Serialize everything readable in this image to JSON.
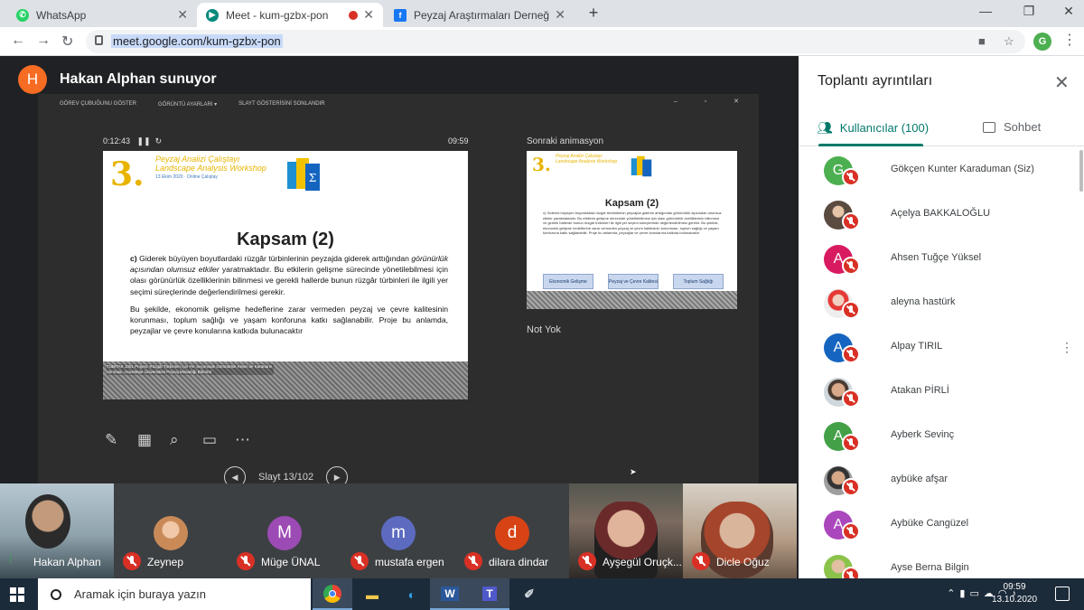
{
  "browser": {
    "tabs": [
      {
        "title": "WhatsApp",
        "favicon_color": "#25d366",
        "icon": "whatsapp-icon"
      },
      {
        "title": "Meet - kum-gzbx-pon",
        "favicon_color": "#00897b",
        "icon": "meet-icon",
        "recording_dot_color": "#d93025"
      },
      {
        "title": "Peyzaj Araştırmaları Derneği - An",
        "favicon_color": "#1877f2",
        "icon": "facebook-icon"
      }
    ],
    "new_tab": "+",
    "url": "meet.google.com/kum-gzbx-pon",
    "profile_initial": "G"
  },
  "meet": {
    "presenter_initial": "H",
    "presenter_label": "Hakan Alphan sunuyor",
    "presenter_avatar_color": "#f76c23",
    "presentation": {
      "toolbar": [
        "GÖREV ÇUBUĞUNU GÖSTER",
        "GÖRÜNTÜ AYARLARI ▾",
        "SLAYT GÖSTERİSİNİ SONLANDIR"
      ],
      "elapsed": "0:12:43",
      "clock": "09:59",
      "next_label": "Sonraki animasyon",
      "notes": "Not Yok",
      "slide_counter": "Slayt 13/102",
      "slide": {
        "logo_number": "3.",
        "logo_line1": "Peyzaj Analizi Çalıştayı",
        "logo_line2": "Landscape Analysis Workshop",
        "logo_sub": "13 Ekim 2020 · Online Çalıştay",
        "title": "Kapsam (2)",
        "p1_lead": "c)",
        "p1_a": " Giderek büyüyen boyutlardaki rüzgâr türbinlerinin peyzajda giderek arttığından ",
        "p1_em": "görünürlük açısından olumsuz etkiler",
        "p1_b": " yaratmaktadır. Bu etkilerin gelişme sürecinde yönetilebilmesi için olası görünürlük özelliklerinin bilinmesi ve gerekli hallerde bunun rüzgâr türbinleri ile ilgili yer seçimi süreçlerinde değerlendirilmesi gerekir.",
        "p2": "Bu şekilde, ekonomik gelişme hedeflerine zarar vermeden peyzaj ve çevre kalitesinin korunması, toplum sağlığı ve yaşam konforuna katkı sağlanabilir. Proje bu anlamda, peyzajlar ve çevre konularına katkıda bulunacaktır",
        "footer": "TÜBİTAK 1001 Projesi: Rüzgâr Türbinleri İçin Yer Seçiminde Görünürlük Kriteri ile Kararların Alınması, Hacettepe Üniversitesi Peyzaj Mimarlığı Bölümü"
      },
      "next_slide": {
        "number": "3.",
        "logo": "Peyzaj Analizi Çalıştayı Landscape Analysis Workshop",
        "title": "Kapsam (2)",
        "body": "c) Giderek büyüyen boyutlardaki rüzgâr türbinlerinin peyzajda giderek arttığından görünürlük açısından olumsuz etkiler yaratmaktadır. Bu etkilerin gelişme sürecinde yönetilebilmesi için olası görünürlük özelliklerinin bilinmesi ve gerekli hallerde bunun rüzgâr türbinleri ile ilgili yer seçimi süreçlerinde değerlendirilmesi gerekir. Bu şekilde, ekonomik gelişme hedeflerine zarar vermeden peyzaj ve çevre kalitesinin korunması, toplum sağlığı ve yaşam konforuna katkı sağlanabilir. Proje bu anlamda, peyzajlar ve çevre konularına katkıda bulunacaktır",
        "buttons": [
          "Ekonomik Gelişme",
          "Peyzaj ve Çevre Kalitesi",
          "Toplum Sağlığı"
        ]
      }
    },
    "participants_tiles": [
      {
        "name": "Hakan Alphan",
        "type": "camera1"
      },
      {
        "name": "Zeynep",
        "type": "photo"
      },
      {
        "name": "Müge ÜNAL",
        "type": "avatar",
        "initial": "M",
        "color": "#9c4bb4"
      },
      {
        "name": "mustafa ergen",
        "type": "avatar",
        "initial": "m",
        "color": "#5c6bc0"
      },
      {
        "name": "dilara dindar",
        "type": "avatar",
        "initial": "d",
        "color": "#d84315"
      },
      {
        "name": "Ayşegül Oruçk...",
        "type": "camera2"
      },
      {
        "name": "Dicle Oğuz",
        "type": "camera3"
      }
    ]
  },
  "sidebar": {
    "title": "Toplantı ayrıntıları",
    "tab_people": "Kullanıcılar (100)",
    "tab_chat": "Sohbet",
    "people": [
      {
        "name": "Gökçen Kunter Karaduman (Siz)",
        "initial": "G",
        "color": "#4caf50"
      },
      {
        "name": "Açelya BAKKALOĞLU",
        "initial": "",
        "color": "#795548"
      },
      {
        "name": "Ahsen Tuğçe Yüksel",
        "initial": "A",
        "color": "#d81b60"
      },
      {
        "name": "aleyna hastürk",
        "initial": "",
        "color": "#a1887f"
      },
      {
        "name": "Alpay TIRIL",
        "initial": "A",
        "color": "#1565c0"
      },
      {
        "name": "Atakan PİRLİ",
        "initial": "",
        "color": "#8d6e63"
      },
      {
        "name": "Ayberk Sevinç",
        "initial": "A",
        "color": "#43a047"
      },
      {
        "name": "aybüke afşar",
        "initial": "",
        "color": "#6d4c41"
      },
      {
        "name": "Aybüke Cangüzel",
        "initial": "A",
        "color": "#ab47bc"
      },
      {
        "name": "Ayse Berna Bilgin",
        "initial": "",
        "color": "#8bc34a"
      }
    ]
  },
  "taskbar": {
    "search_placeholder": "Aramak için buraya yazın",
    "time": "09:59",
    "date": "13.10.2020"
  }
}
